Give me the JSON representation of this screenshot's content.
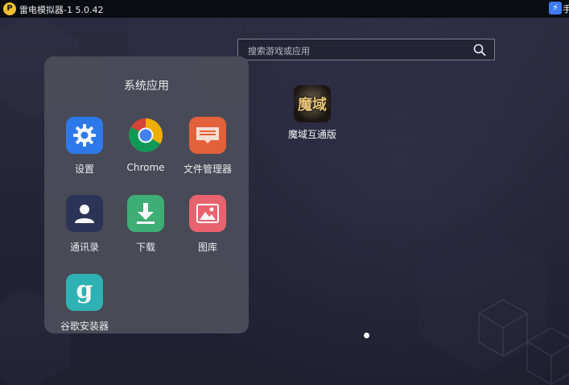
{
  "titlebar": {
    "logo_glyph": "P",
    "title": "雷电模拟器-1 5.0.42",
    "right_partial": "手"
  },
  "search": {
    "placeholder": "搜索游戏或应用"
  },
  "folder": {
    "title": "系统应用",
    "apps": [
      {
        "label": "设置",
        "icon": "settings-icon",
        "color": "#2f7cf0"
      },
      {
        "label": "Chrome",
        "icon": "chrome-icon",
        "color": "#ffffff"
      },
      {
        "label": "文件管理器",
        "icon": "file-manager-icon",
        "color": "#e9633a"
      },
      {
        "label": "通讯录",
        "icon": "contacts-icon",
        "color": "#2d3558"
      },
      {
        "label": "下载",
        "icon": "download-icon",
        "color": "#3fb378"
      },
      {
        "label": "图库",
        "icon": "gallery-icon",
        "color": "#ee6670"
      },
      {
        "label": "谷歌安装器",
        "icon": "google-installer-icon",
        "color": "#2fb6b8",
        "glyph": "g"
      }
    ]
  },
  "desktop": {
    "apps": [
      {
        "label": "魔域互通版",
        "icon": "moyu-game-icon",
        "glyph": "魔域"
      }
    ]
  }
}
